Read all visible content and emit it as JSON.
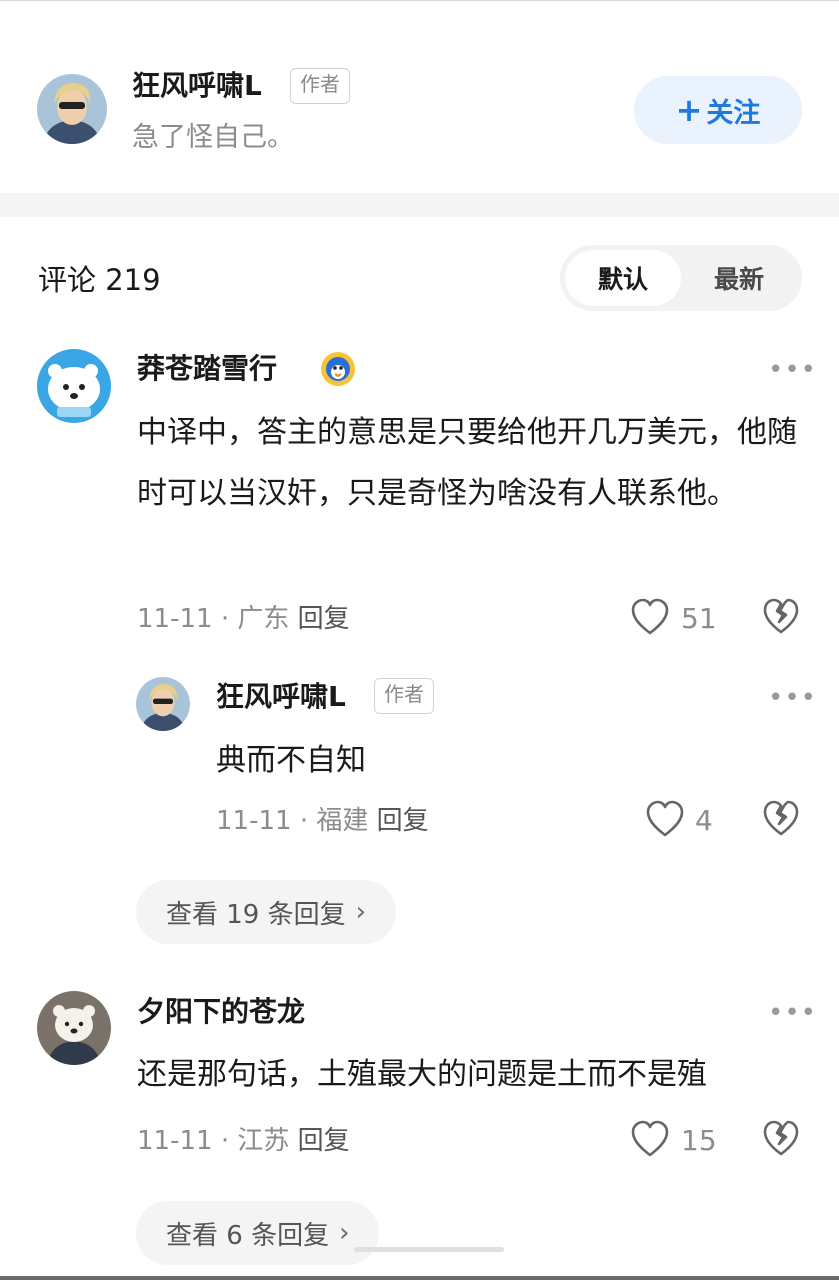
{
  "author": {
    "name": "狂风呼啸L",
    "tag": "作者",
    "bio": "急了怪自己。",
    "follow_plus": "+",
    "follow_label": "关注"
  },
  "comments_header": {
    "title": "评论 219",
    "sort_default": "默认",
    "sort_latest": "最新"
  },
  "comments": [
    {
      "user": "莽苍踏雪行",
      "text": "中译中，答主的意思是只要给他开几万美元，他随时可以当汉奸，只是奇怪为啥没有人联系他。",
      "date": "11-11",
      "location": "· 广东",
      "reply": "回复",
      "likes": "51",
      "replies": [
        {
          "user": "狂风呼啸L",
          "tag": "作者",
          "text": "典而不自知",
          "date": "11-11",
          "location": "· 福建",
          "reply": "回复",
          "likes": "4"
        }
      ],
      "view_replies": "查看 19 条回复"
    },
    {
      "user": "夕阳下的苍龙",
      "text": "还是那句话，土殖最大的问题是土而不是殖",
      "date": "11-11",
      "location": "· 江苏",
      "reply": "回复",
      "likes": "15",
      "view_replies": "查看 6 条回复"
    }
  ],
  "icons": {
    "more": "more-dots-icon",
    "like": "heart-outline-icon",
    "dislike": "broken-heart-icon",
    "chevron": "chevron-right-icon"
  },
  "colors": {
    "accent": "#1f7ae0",
    "follow_bg": "#e9f2fd",
    "meta_gray": "#8c8c8c"
  }
}
